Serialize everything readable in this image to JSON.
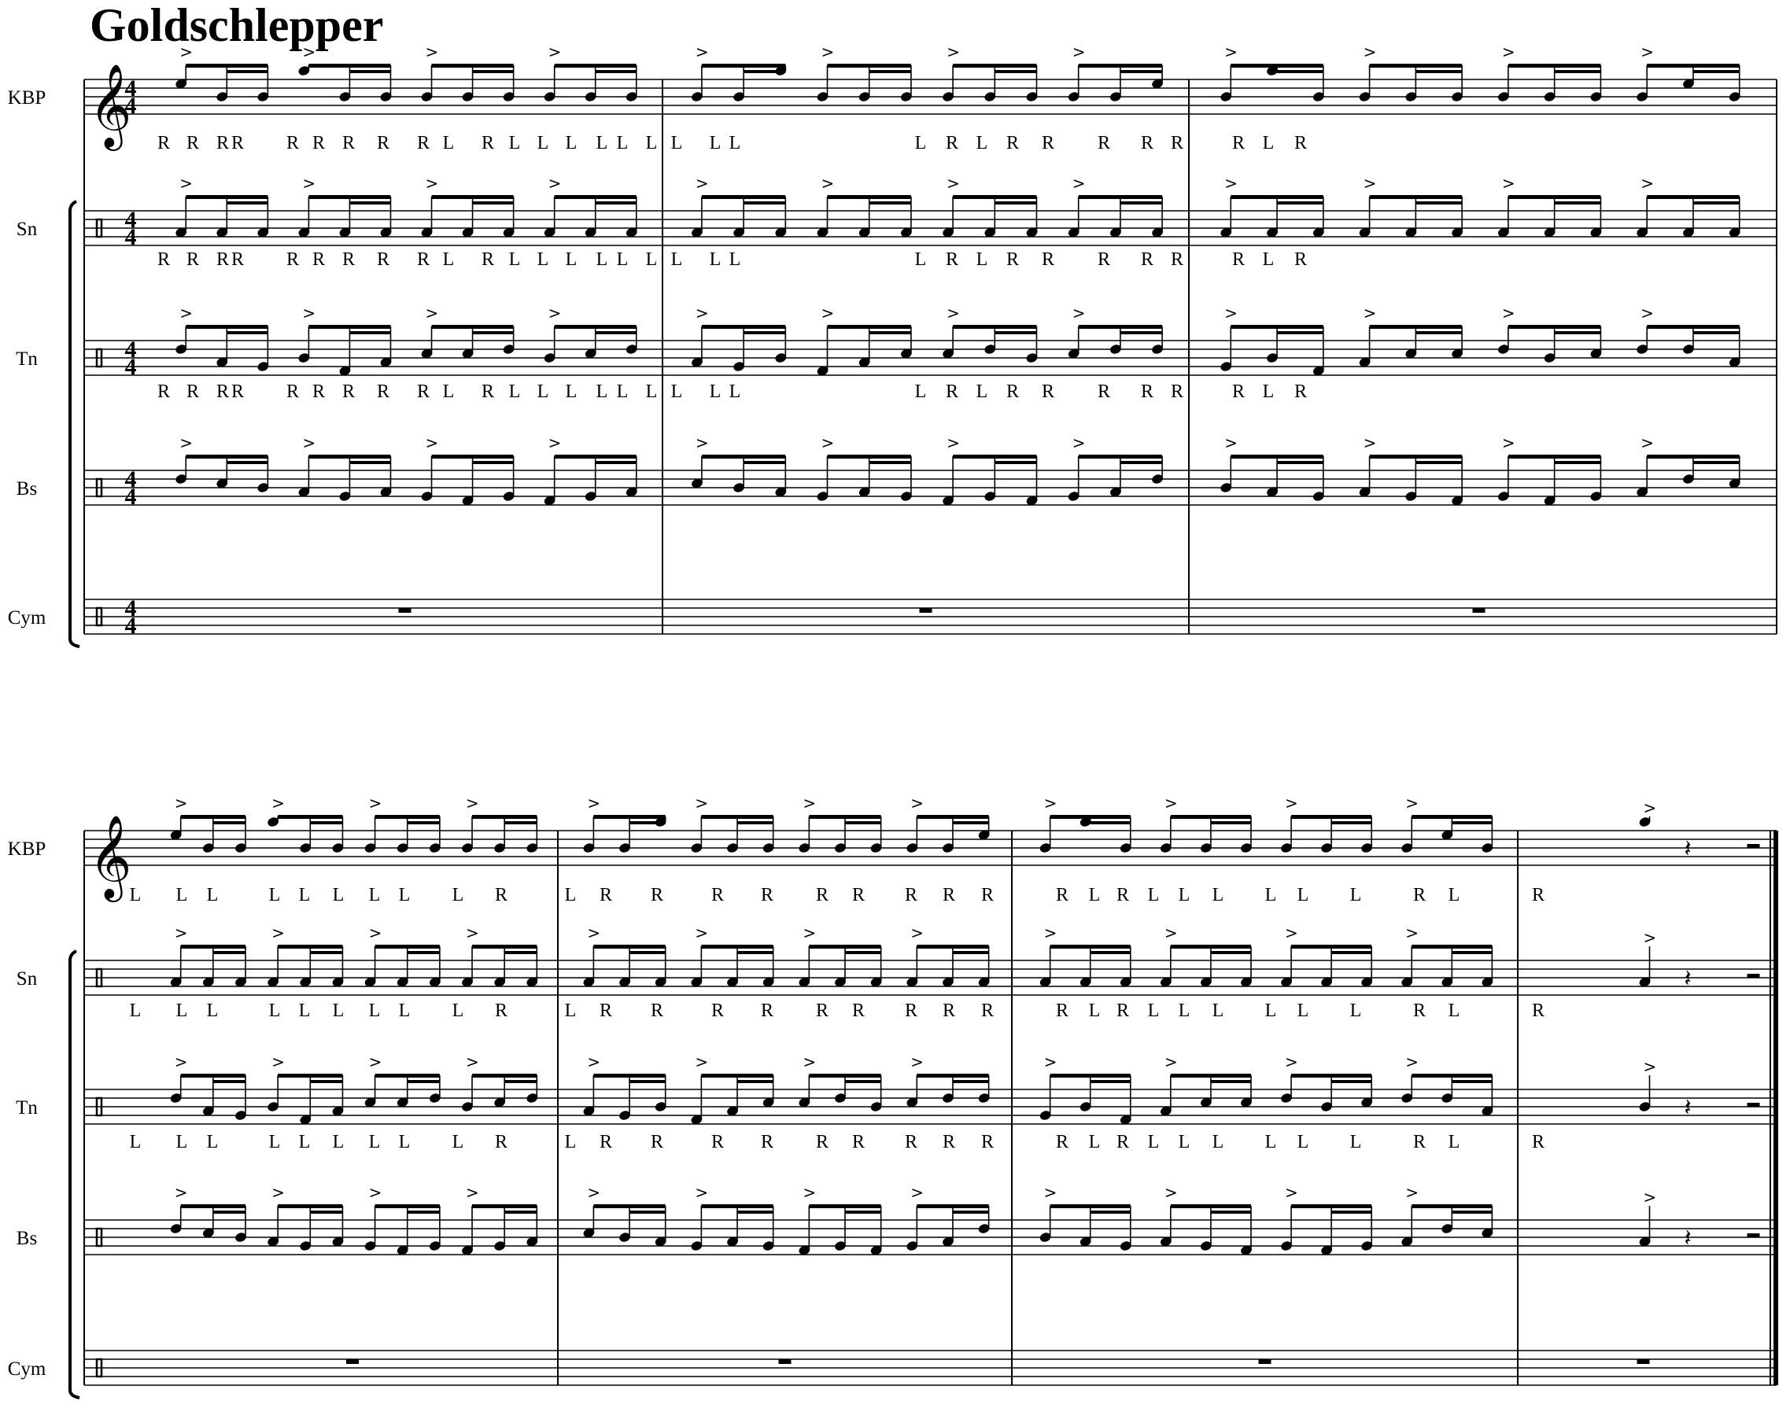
{
  "title": "Goldschlepper",
  "time_signature": {
    "numerator": "4",
    "denominator": "4"
  },
  "instruments": [
    "KBP",
    "Sn",
    "Tn",
    "Bs",
    "Cym"
  ],
  "glyphs": {
    "treble_clef": "𝄞",
    "flat": "♭",
    "accent": ">",
    "rest16": "𝄿",
    "rest_quarter": "𝄽"
  },
  "systems": [
    {
      "measures": 3,
      "sticking": [
        [
          "R",
          "R",
          "R",
          "R",
          "R",
          "R",
          "R",
          "R",
          "R",
          "L"
        ],
        [
          "R",
          "L",
          "L",
          "L",
          "L",
          "L",
          "L",
          "L",
          "L",
          "L"
        ],
        [
          "L",
          "R",
          "L",
          "R",
          "R",
          "R",
          "R",
          "R",
          "R",
          "L",
          "R"
        ]
      ]
    },
    {
      "measures": 4,
      "sticking": [
        [
          "L",
          "L",
          "L",
          "L",
          "L",
          "L",
          "L",
          "L",
          "L",
          "R"
        ],
        [
          "L",
          "R",
          "R",
          "R",
          "R",
          "R",
          "R",
          "R",
          "R",
          "R"
        ],
        [
          "R",
          "L",
          "R",
          "L",
          "L",
          "L",
          "L",
          "L",
          "L",
          "R",
          "L"
        ],
        [
          "R"
        ]
      ]
    }
  ]
}
